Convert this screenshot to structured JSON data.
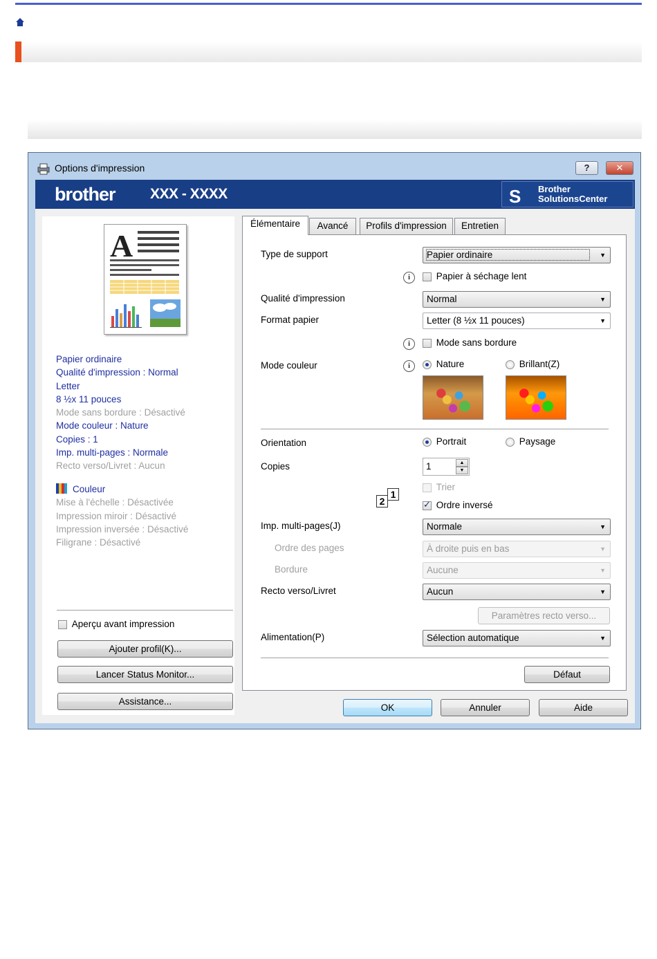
{
  "dialog": {
    "title": "Options d'impression",
    "help_label": "?",
    "close_label": "✕",
    "brand": "brother",
    "model": "XXX - XXXX",
    "solutions_center": "Brother\nSolutionsCenter"
  },
  "summary": {
    "lines": [
      {
        "text": "Papier ordinaire",
        "active": true
      },
      {
        "text": "Qualité d'impression : Normal",
        "active": true
      },
      {
        "text": "Letter",
        "active": true
      },
      {
        "text": "8 ½x 11 pouces",
        "active": true
      },
      {
        "text": "Mode sans bordure : Désactivé",
        "active": false
      },
      {
        "text": "Mode couleur : Nature",
        "active": true
      },
      {
        "text": "Copies : 1",
        "active": true
      },
      {
        "text": "Imp. multi-pages : Normale",
        "active": true
      },
      {
        "text": "Recto verso/Livret : Aucun",
        "active": false
      }
    ],
    "color_label": "Couleur",
    "lines2": [
      "Mise à l'échelle : Désactivée",
      "Impression miroir : Désactivé",
      "Impression inversée : Désactivé",
      "Filigrane : Désactivé"
    ]
  },
  "left_controls": {
    "preview_checkbox": "Aperçu avant impression",
    "add_profile": "Ajouter profil(K)...",
    "status_monitor": "Lancer Status Monitor...",
    "assistance": "Assistance..."
  },
  "tabs": [
    "Élémentaire",
    "Avancé",
    "Profils d'impression",
    "Entretien"
  ],
  "basic": {
    "media_type_label": "Type de support",
    "media_type_value": "Papier ordinaire",
    "slow_drying": "Papier à séchage lent",
    "quality_label": "Qualité d'impression",
    "quality_value": "Normal",
    "paper_size_label": "Format papier",
    "paper_size_value": "Letter (8 ½x 11 pouces)",
    "borderless": "Mode sans bordure",
    "color_mode_label": "Mode couleur",
    "color_natural": "Nature",
    "color_vivid": "Brillant(Z)",
    "orientation_label": "Orientation",
    "portrait": "Portrait",
    "landscape": "Paysage",
    "copies_label": "Copies",
    "copies_value": "1",
    "collate": "Trier",
    "reverse_order": "Ordre inversé",
    "multipage_label": "Imp. multi-pages(J)",
    "multipage_value": "Normale",
    "page_order_label": "Ordre des pages",
    "page_order_value": "À droite puis en bas",
    "border_label": "Bordure",
    "border_value": "Aucune",
    "duplex_label": "Recto verso/Livret",
    "duplex_value": "Aucun",
    "duplex_settings": "Paramètres recto verso...",
    "source_label": "Alimentation(P)",
    "source_value": "Sélection automatique",
    "default_btn": "Défaut"
  },
  "footer": {
    "ok": "OK",
    "cancel": "Annuler",
    "help": "Aide"
  },
  "colors": {
    "banner": "#183e86",
    "accent": "#e8501e",
    "active_text": "#1f2fa0",
    "disabled_text": "#a0a0a0"
  }
}
